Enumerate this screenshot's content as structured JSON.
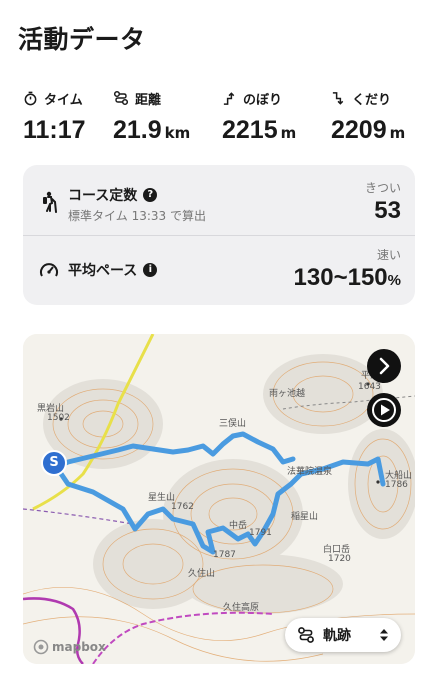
{
  "page_title": "活動データ",
  "stats": [
    {
      "label": "タイム",
      "value": "11:17",
      "unit": "",
      "icon": "stopwatch-icon"
    },
    {
      "label": "距離",
      "value": "21.9",
      "unit": "km",
      "icon": "route-icon"
    },
    {
      "label": "のぼり",
      "value": "2215",
      "unit": "m",
      "icon": "ascent-icon"
    },
    {
      "label": "くだり",
      "value": "2209",
      "unit": "m",
      "icon": "descent-icon"
    }
  ],
  "course": {
    "label": "コース定数",
    "sub": "標準タイム 13:33 で算出",
    "right_label": "きつい",
    "value": "53"
  },
  "pace": {
    "label": "平均ペース",
    "right_label": "速い",
    "value": "130~150",
    "unit": "%"
  },
  "map": {
    "track_button_label": "軌跡",
    "attribution": "mapbox",
    "start_marker": "S",
    "place_labels": [
      "黒岩山",
      "1502",
      "雨ヶ池越",
      "平治岳",
      "1643",
      "三俣山",
      "法華院温泉",
      "大船山",
      "1786",
      "星生山",
      "1762",
      "中岳",
      "1791",
      "稲星山",
      "1787",
      "久住山",
      "久住高原",
      "白口岳",
      "1720"
    ],
    "colors": {
      "track": "#4a9be0",
      "contour": "#e0a060",
      "road": "#e8e04a"
    }
  }
}
